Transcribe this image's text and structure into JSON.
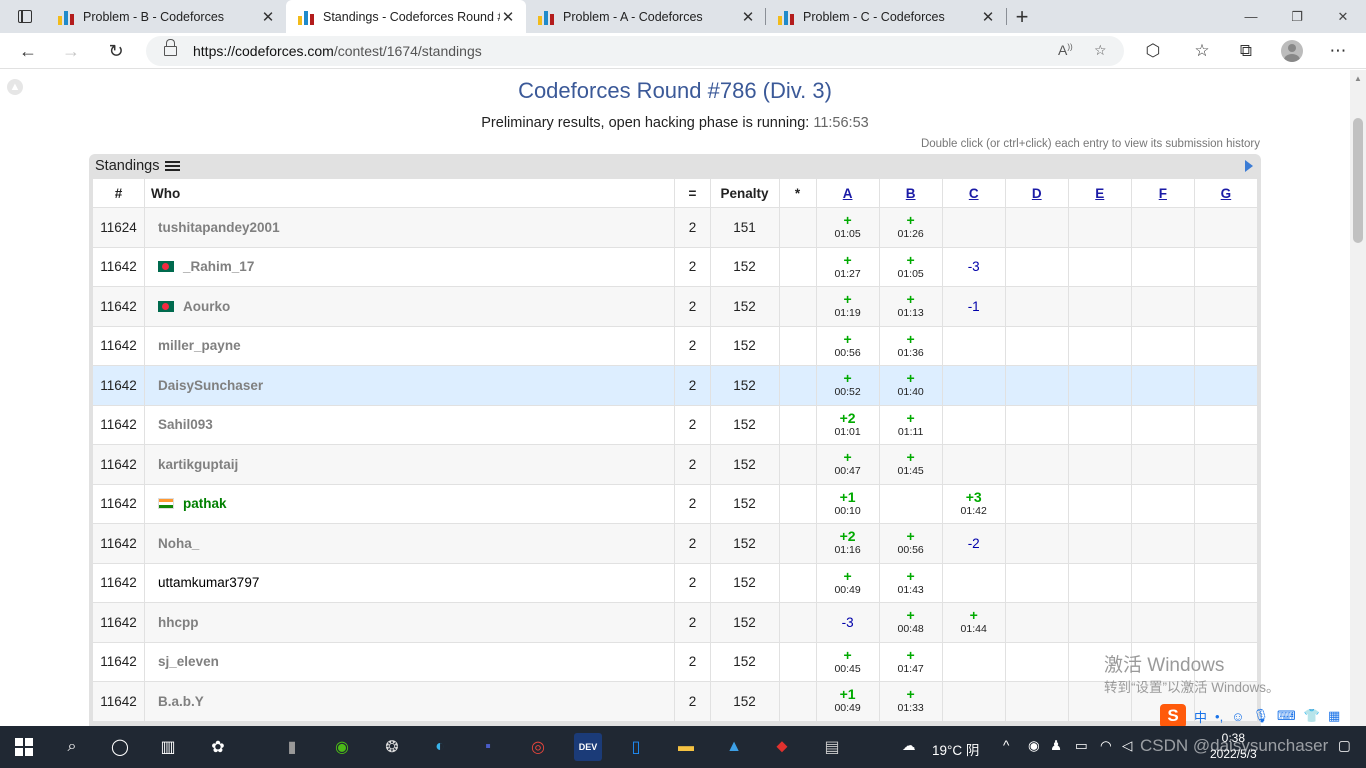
{
  "browser": {
    "tabs": [
      {
        "title": "Problem - B - Codeforces",
        "active": false
      },
      {
        "title": "Standings - Codeforces Round #",
        "active": true
      },
      {
        "title": "Problem - A - Codeforces",
        "active": false
      },
      {
        "title": "Problem - C - Codeforces",
        "active": false
      }
    ],
    "new_tab": "+",
    "url_host": "https://codeforces.com",
    "url_path": "/contest/1674/standings",
    "window_controls": [
      "—",
      "❐",
      "✕"
    ]
  },
  "page": {
    "title": "Codeforces Round #786 (Div. 3)",
    "phase_text": "Preliminary results, open hacking phase is running:",
    "timer": "11:56:53",
    "hint": "Double click (or ctrl+click) each entry to view its submission history",
    "standings_label": "Standings",
    "columns": [
      "#",
      "Who",
      "=",
      "Penalty",
      "*",
      "A",
      "B",
      "C",
      "D",
      "E",
      "F",
      "G"
    ],
    "rows": [
      {
        "rank": "11624",
        "who": "tushitapandey2001",
        "flag": "",
        "color": "gray",
        "solved": "2",
        "penalty": "151",
        "A": {
          "acc": "+",
          "time": "01:05"
        },
        "B": {
          "acc": "+",
          "time": "01:26"
        },
        "C": null
      },
      {
        "rank": "11642",
        "who": "_Rahim_17",
        "flag": "bd",
        "color": "gray",
        "solved": "2",
        "penalty": "152",
        "A": {
          "acc": "+",
          "time": "01:27"
        },
        "B": {
          "acc": "+",
          "time": "01:05"
        },
        "C": {
          "rej": "-3"
        }
      },
      {
        "rank": "11642",
        "who": "Aourko",
        "flag": "bd",
        "color": "gray",
        "solved": "2",
        "penalty": "152",
        "A": {
          "acc": "+",
          "time": "01:19"
        },
        "B": {
          "acc": "+",
          "time": "01:13"
        },
        "C": {
          "rej": "-1"
        }
      },
      {
        "rank": "11642",
        "who": "miller_payne",
        "flag": "",
        "color": "gray",
        "solved": "2",
        "penalty": "152",
        "A": {
          "acc": "+",
          "time": "00:56"
        },
        "B": {
          "acc": "+",
          "time": "01:36"
        },
        "C": null
      },
      {
        "rank": "11642",
        "who": "DaisySunchaser",
        "flag": "",
        "color": "gray",
        "solved": "2",
        "penalty": "152",
        "A": {
          "acc": "+",
          "time": "00:52"
        },
        "B": {
          "acc": "+",
          "time": "01:40"
        },
        "C": null,
        "highlight": true
      },
      {
        "rank": "11642",
        "who": "Sahil093",
        "flag": "",
        "color": "gray",
        "solved": "2",
        "penalty": "152",
        "A": {
          "acc": "+2",
          "time": "01:01"
        },
        "B": {
          "acc": "+",
          "time": "01:11"
        },
        "C": null
      },
      {
        "rank": "11642",
        "who": "kartikguptaij",
        "flag": "",
        "color": "gray",
        "solved": "2",
        "penalty": "152",
        "A": {
          "acc": "+",
          "time": "00:47"
        },
        "B": {
          "acc": "+",
          "time": "01:45"
        },
        "C": null
      },
      {
        "rank": "11642",
        "who": "pathak",
        "flag": "in",
        "color": "green",
        "solved": "2",
        "penalty": "152",
        "A": {
          "acc": "+1",
          "time": "00:10"
        },
        "B": null,
        "C": {
          "acc": "+3",
          "time": "01:42"
        }
      },
      {
        "rank": "11642",
        "who": "Noha_",
        "flag": "",
        "color": "gray",
        "solved": "2",
        "penalty": "152",
        "A": {
          "acc": "+2",
          "time": "01:16"
        },
        "B": {
          "acc": "+",
          "time": "00:56"
        },
        "C": {
          "rej": "-2"
        }
      },
      {
        "rank": "11642",
        "who": "uttamkumar3797",
        "flag": "",
        "color": "black",
        "solved": "2",
        "penalty": "152",
        "A": {
          "acc": "+",
          "time": "00:49"
        },
        "B": {
          "acc": "+",
          "time": "01:43"
        },
        "C": null
      },
      {
        "rank": "11642",
        "who": "hhcpp",
        "flag": "",
        "color": "gray",
        "solved": "2",
        "penalty": "152",
        "A": {
          "rej": "-3"
        },
        "B": {
          "acc": "+",
          "time": "00:48"
        },
        "C": {
          "acc": "+",
          "time": "01:44"
        }
      },
      {
        "rank": "11642",
        "who": "sj_eleven",
        "flag": "",
        "color": "gray",
        "solved": "2",
        "penalty": "152",
        "A": {
          "acc": "+",
          "time": "00:45"
        },
        "B": {
          "acc": "+",
          "time": "01:47"
        },
        "C": null
      },
      {
        "rank": "11642",
        "who": "B.a.b.Y",
        "flag": "",
        "color": "gray",
        "solved": "2",
        "penalty": "152",
        "A": {
          "acc": "+1",
          "time": "00:49"
        },
        "B": {
          "acc": "+",
          "time": "01:33"
        },
        "C": null
      }
    ]
  },
  "overlay": {
    "activate_title": "激活 Windows",
    "activate_sub": "转到“设置”以激活 Windows。",
    "ime_label": "中"
  },
  "taskbar": {
    "weather": "19°C 阴",
    "time": "0:38",
    "date": "2022/5/3",
    "watermark": "CSDN @daisysunchaser"
  }
}
